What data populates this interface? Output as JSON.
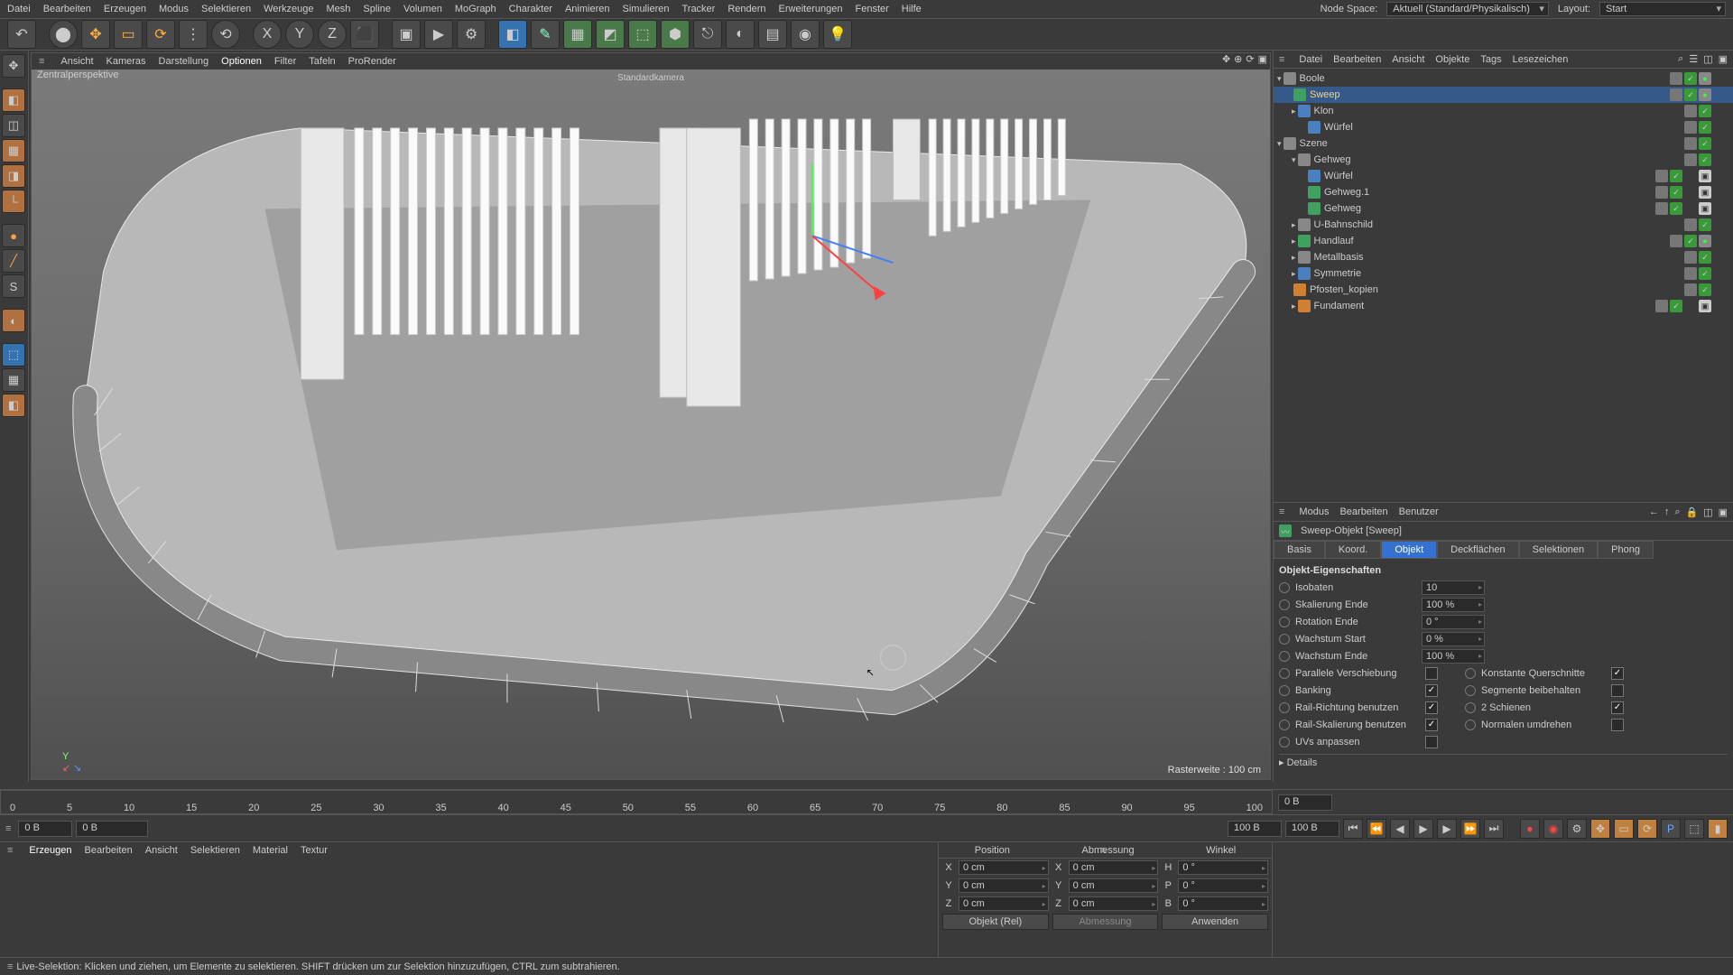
{
  "app_menu": [
    "Datei",
    "Bearbeiten",
    "Erzeugen",
    "Modus",
    "Selektieren",
    "Werkzeuge",
    "Mesh",
    "Spline",
    "Volumen",
    "MoGraph",
    "Charakter",
    "Animieren",
    "Simulieren",
    "Tracker",
    "Rendern",
    "Erweiterungen",
    "Fenster",
    "Hilfe"
  ],
  "node_space_label": "Node Space:",
  "node_space_value": "Aktuell (Standard/Physikalisch)",
  "layout_label": "Layout:",
  "layout_value": "Start",
  "obj_menu": [
    "Datei",
    "Bearbeiten",
    "Ansicht",
    "Objekte",
    "Tags",
    "Lesezeichen"
  ],
  "viewport_menu": [
    "Ansicht",
    "Kameras",
    "Darstellung",
    "Optionen",
    "Filter",
    "Tafeln",
    "ProRender"
  ],
  "viewport_label": "Zentralperspektive",
  "camera_label": "Standardkamera",
  "grid_info": "Rasterweite : 100 cm",
  "axis_label": "Y",
  "mat_menu": [
    "Erzeugen",
    "Bearbeiten",
    "Ansicht",
    "Selektieren",
    "Material",
    "Textur"
  ],
  "attr_menu": [
    "Modus",
    "Bearbeiten",
    "Benutzer"
  ],
  "attr_title": "Sweep-Objekt [Sweep]",
  "attr_tabs": [
    "Basis",
    "Koord.",
    "Objekt",
    "Deckflächen",
    "Selektionen",
    "Phong"
  ],
  "attr_tab_active": 2,
  "attr_section": "Objekt-Eigenschaften",
  "attr_rows_num": [
    {
      "label": "Isobaten",
      "val": "10"
    },
    {
      "label": "Skalierung Ende",
      "val": "100 %"
    },
    {
      "label": "Rotation Ende",
      "val": "0 °"
    },
    {
      "label": "Wachstum Start",
      "val": "0 %"
    },
    {
      "label": "Wachstum Ende",
      "val": "100 %"
    }
  ],
  "attr_checks_left": [
    {
      "label": "Parallele Verschiebung",
      "on": false
    },
    {
      "label": "Banking",
      "on": true
    },
    {
      "label": "Rail-Richtung benutzen",
      "on": true
    },
    {
      "label": "Rail-Skalierung benutzen",
      "on": true
    },
    {
      "label": "UVs anpassen",
      "on": false
    }
  ],
  "attr_checks_right": [
    {
      "label": "Konstante Querschnitte",
      "on": true
    },
    {
      "label": "Segmente beibehalten",
      "on": false
    },
    {
      "label": "2 Schienen",
      "on": true
    },
    {
      "label": "Normalen umdrehen",
      "on": false
    }
  ],
  "attr_details": "Details",
  "objects": [
    {
      "d": 0,
      "exp": "▾",
      "ico": "null",
      "name": "Boole",
      "sel": false,
      "tags": [
        "grey",
        "green",
        "greendot"
      ]
    },
    {
      "d": 1,
      "exp": "",
      "ico": "green",
      "name": "Sweep",
      "sel": true,
      "tags": [
        "grey",
        "green",
        "greendot"
      ]
    },
    {
      "d": 1,
      "exp": "▸",
      "ico": "blue",
      "name": "Klon",
      "sel": false,
      "tags": [
        "grey",
        "green"
      ]
    },
    {
      "d": 2,
      "exp": "",
      "ico": "blue",
      "name": "Würfel",
      "sel": false,
      "tags": [
        "grey",
        "green"
      ]
    },
    {
      "d": 0,
      "exp": "▾",
      "ico": "null",
      "name": "Szene",
      "sel": false,
      "tags": [
        "grey",
        "green"
      ]
    },
    {
      "d": 1,
      "exp": "▾",
      "ico": "null",
      "name": "Gehweg",
      "sel": false,
      "tags": [
        "grey",
        "green"
      ]
    },
    {
      "d": 2,
      "exp": "",
      "ico": "blue",
      "name": "Würfel",
      "sel": false,
      "tags": [
        "grey",
        "green",
        "",
        "chk"
      ]
    },
    {
      "d": 2,
      "exp": "",
      "ico": "green",
      "name": "Gehweg.1",
      "sel": false,
      "tags": [
        "grey",
        "green",
        "",
        "chk"
      ]
    },
    {
      "d": 2,
      "exp": "",
      "ico": "green",
      "name": "Gehweg",
      "sel": false,
      "tags": [
        "grey",
        "green",
        "",
        "chk"
      ]
    },
    {
      "d": 1,
      "exp": "▸",
      "ico": "null",
      "name": "U-Bahnschild",
      "sel": false,
      "tags": [
        "grey",
        "green"
      ]
    },
    {
      "d": 1,
      "exp": "▸",
      "ico": "green",
      "name": "Handlauf",
      "sel": false,
      "tags": [
        "grey",
        "green",
        "greendot"
      ]
    },
    {
      "d": 1,
      "exp": "▸",
      "ico": "null",
      "name": "Metallbasis",
      "sel": false,
      "tags": [
        "grey",
        "green"
      ]
    },
    {
      "d": 1,
      "exp": "▸",
      "ico": "blue",
      "name": "Symmetrie",
      "sel": false,
      "tags": [
        "grey",
        "green"
      ]
    },
    {
      "d": 1,
      "exp": "",
      "ico": "orange",
      "name": "Pfosten_kopien",
      "sel": false,
      "tags": [
        "grey",
        "green"
      ]
    },
    {
      "d": 1,
      "exp": "▸",
      "ico": "orange",
      "name": "Fundament",
      "sel": false,
      "tags": [
        "grey",
        "green",
        "",
        "chk"
      ]
    }
  ],
  "timeline": {
    "ticks": [
      "0",
      "5",
      "10",
      "15",
      "20",
      "25",
      "30",
      "35",
      "40",
      "45",
      "50",
      "55",
      "60",
      "65",
      "70",
      "75",
      "80",
      "85",
      "90",
      "95",
      "100"
    ],
    "frame": "0 B",
    "start": "0 B",
    "stop": "100 B",
    "end": "100 B"
  },
  "coord": {
    "headers": [
      "Position",
      "Abmessung",
      "Winkel"
    ],
    "rows": [
      {
        "a": "X",
        "v1": "0 cm",
        "b": "X",
        "v2": "0 cm",
        "c": "H",
        "v3": "0 °"
      },
      {
        "a": "Y",
        "v1": "0 cm",
        "b": "Y",
        "v2": "0 cm",
        "c": "P",
        "v3": "0 °"
      },
      {
        "a": "Z",
        "v1": "0 cm",
        "b": "Z",
        "v2": "0 cm",
        "c": "B",
        "v3": "0 °"
      }
    ],
    "mode1": "Objekt (Rel)",
    "mode2": "Abmessung",
    "apply": "Anwenden"
  },
  "status": "Live-Selektion: Klicken und ziehen, um Elemente zu selektieren. SHIFT drücken um zur Selektion hinzuzufügen, CTRL zum subtrahieren."
}
